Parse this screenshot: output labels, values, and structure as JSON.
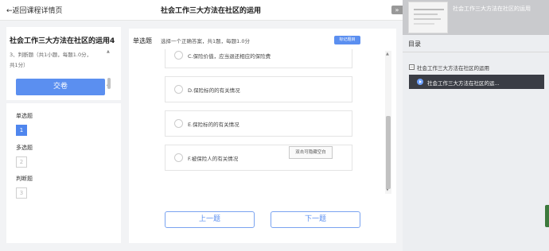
{
  "topbar": {
    "back_label": "返回课程详情页",
    "title": "社会工作三大方法在社区的运用",
    "collapse_label": "»"
  },
  "left": {
    "course_title": "社会工作三大方法在社区的运用4",
    "summary_line1": "3、判断题（共1小题，每题1.0分，",
    "summary_line2": "共1分）",
    "submit_label": "交卷"
  },
  "nav": {
    "sections": [
      {
        "label": "单选题",
        "number": "1",
        "active": true
      },
      {
        "label": "多选题",
        "number": "2",
        "active": false
      },
      {
        "label": "判断题",
        "number": "3",
        "active": false
      }
    ]
  },
  "question": {
    "type_label": "单选题",
    "description": "选择一个正确答案，共1题，每题1.0分",
    "mark_label": "标记题目",
    "options": [
      {
        "text": "C.保险价值，应当退还相应的保险费"
      },
      {
        "text": "D.保险标的的有关情况"
      },
      {
        "text": "E.保险标的的有关情况"
      },
      {
        "text": "F.被保险人的有关情况"
      }
    ],
    "tooltip": "双击可隐藏空白",
    "prev_label": "上一题",
    "next_label": "下一题"
  },
  "right": {
    "video_title": "社会工作三大方法在社区的运用",
    "toc_label": "目录",
    "chapter": "社会工作三大方法在社区的运用",
    "chapter_icon": "−",
    "lesson": "社会工作三大方法在社区的运..."
  },
  "colors": {
    "accent": "#5b8ff0",
    "active_lesson_bg": "#3a3d45"
  },
  "icons": {
    "back": "arrow-left-icon",
    "play": "play-icon",
    "collapse": "double-chevron-icon"
  }
}
